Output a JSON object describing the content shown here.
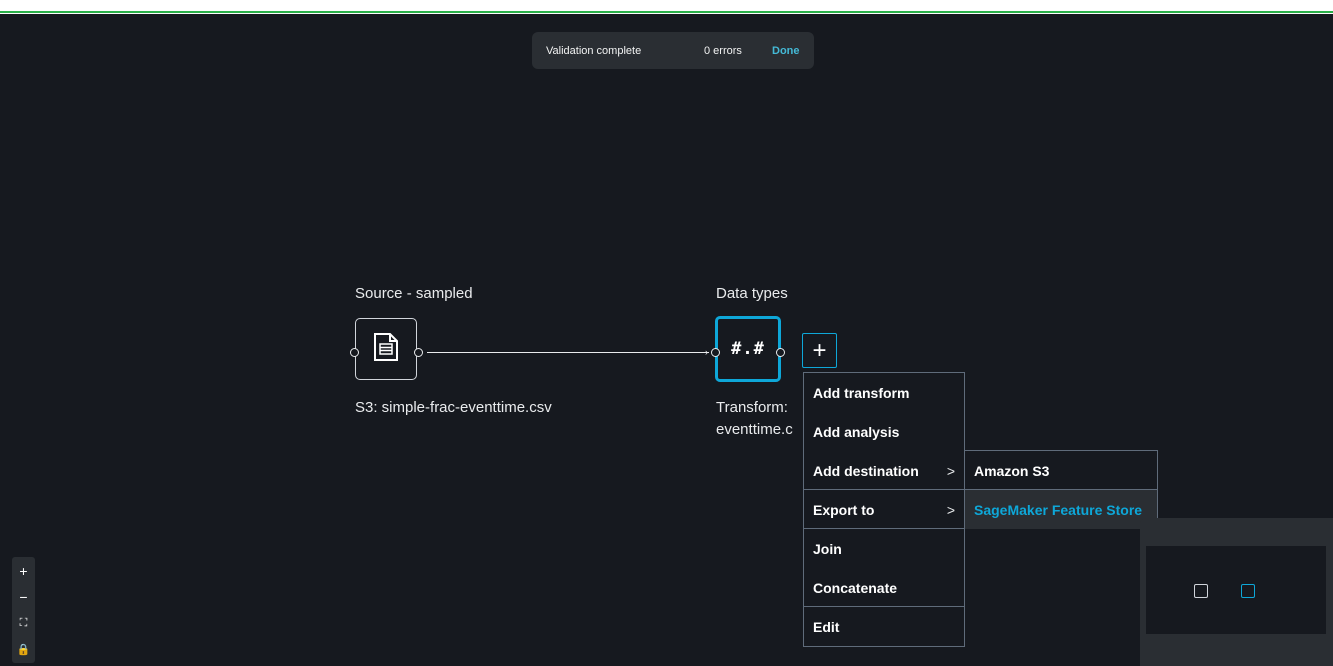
{
  "validation": {
    "title": "Validation complete",
    "errors": "0 errors",
    "done": "Done"
  },
  "nodes": {
    "source": {
      "label": "Source - sampled",
      "caption": "S3: simple-frac-eventtime.csv",
      "icon": "document-icon"
    },
    "datatypes": {
      "label": "Data types",
      "glyph": "#.#",
      "caption_line1": "Transform:",
      "caption_line2": "eventtime.c"
    }
  },
  "add_button": {
    "label": "+"
  },
  "context_menu": {
    "items": [
      {
        "label": "Add transform"
      },
      {
        "label": "Add analysis"
      },
      {
        "label": "Add destination",
        "chevron": ">"
      },
      {
        "label": "Export to",
        "chevron": ">"
      },
      {
        "label": "Join"
      },
      {
        "label": "Concatenate"
      },
      {
        "label": "Edit"
      }
    ]
  },
  "submenu": {
    "items": [
      {
        "label": "Amazon S3"
      },
      {
        "label": "SageMaker Feature Store"
      }
    ]
  },
  "zoom_controls": {
    "zoom_in": "+",
    "zoom_out": "−",
    "fit": "⛶",
    "lock": "🔒"
  },
  "colors": {
    "background": "#16191f",
    "accent": "#0ea7d8",
    "panel": "#2a2e33",
    "status_green": "#2bb14a"
  }
}
